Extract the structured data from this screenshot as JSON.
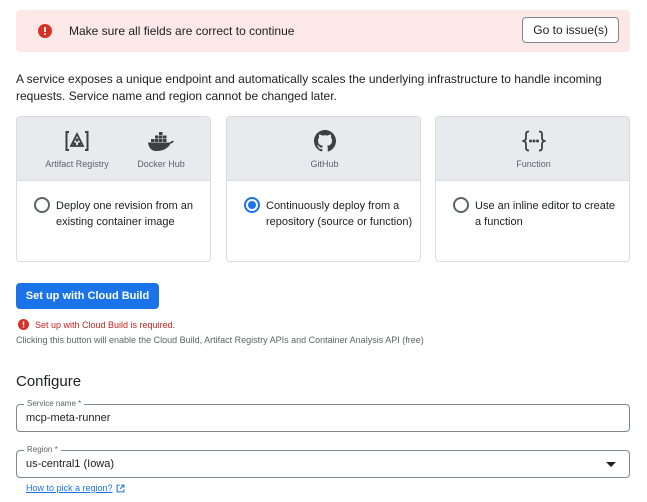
{
  "alert": {
    "message": "Make sure all fields are correct to continue",
    "button_label": "Go to issue(s)",
    "icon": "error-icon",
    "color": "#d93025"
  },
  "intro": {
    "text": "A service exposes a unique endpoint and automatically scales the underlying infrastructure to handle incoming requests. Service name and region cannot be changed later."
  },
  "sources": [
    {
      "options": [
        {
          "icon": "artifact-registry-icon",
          "label": "Artifact Registry"
        },
        {
          "icon": "docker-hub-icon",
          "label": "Docker Hub"
        }
      ],
      "description": "Deploy one revision from an existing container image",
      "selected": false
    },
    {
      "options": [
        {
          "icon": "github-icon",
          "label": "GitHub"
        }
      ],
      "description": "Continuously deploy from a repository (source or function)",
      "selected": true
    },
    {
      "options": [
        {
          "icon": "function-icon",
          "label": "Function"
        }
      ],
      "description": "Use an inline editor to create a function",
      "selected": false
    }
  ],
  "cloud_build": {
    "button_label": "Set up with Cloud Build",
    "error": "Set up with Cloud Build is required.",
    "hint": "Clicking this button will enable the Cloud Build, Artifact Registry APIs and Container Analysis API (free)"
  },
  "configure": {
    "title": "Configure",
    "service_name": {
      "label": "Service name *",
      "value": "mcp-meta-runner"
    },
    "region": {
      "label": "Region *",
      "value": "us-central1 (Iowa)"
    },
    "help_link": "How to pick a region?"
  },
  "colors": {
    "primary": "#1a73e8",
    "error": "#d93025",
    "alert_bg": "#fce8e6"
  }
}
